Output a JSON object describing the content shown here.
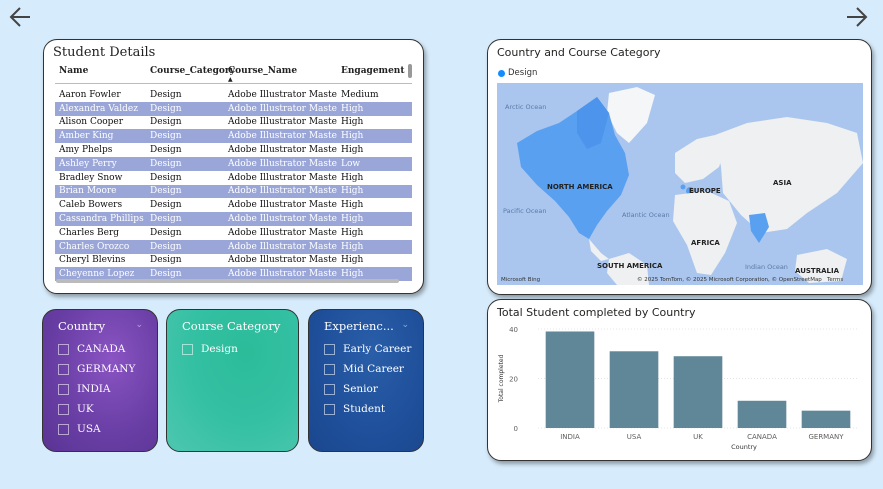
{
  "nav": {
    "back": "back-arrow",
    "forward": "forward-arrow"
  },
  "table": {
    "title": "Student Details",
    "columns": [
      "Name",
      "Course_Category",
      "Course_Name",
      "Engagement Lev"
    ],
    "rows": [
      {
        "name": "Aaron Fowler",
        "category": "Design",
        "course": "Adobe Illustrator Mastery",
        "engagement": "Medium",
        "selected": false
      },
      {
        "name": "Alexandra Valdez",
        "category": "Design",
        "course": "Adobe Illustrator Mastery",
        "engagement": "High",
        "selected": true
      },
      {
        "name": "Alison Cooper",
        "category": "Design",
        "course": "Adobe Illustrator Mastery",
        "engagement": "High",
        "selected": false
      },
      {
        "name": "Amber King",
        "category": "Design",
        "course": "Adobe Illustrator Mastery",
        "engagement": "High",
        "selected": true
      },
      {
        "name": "Amy Phelps",
        "category": "Design",
        "course": "Adobe Illustrator Mastery",
        "engagement": "High",
        "selected": false
      },
      {
        "name": "Ashley Perry",
        "category": "Design",
        "course": "Adobe Illustrator Mastery",
        "engagement": "Low",
        "selected": true
      },
      {
        "name": "Bradley Snow",
        "category": "Design",
        "course": "Adobe Illustrator Mastery",
        "engagement": "High",
        "selected": false
      },
      {
        "name": "Brian Moore",
        "category": "Design",
        "course": "Adobe Illustrator Mastery",
        "engagement": "High",
        "selected": true
      },
      {
        "name": "Caleb Bowers",
        "category": "Design",
        "course": "Adobe Illustrator Mastery",
        "engagement": "High",
        "selected": false
      },
      {
        "name": "Cassandra Phillips",
        "category": "Design",
        "course": "Adobe Illustrator Mastery",
        "engagement": "High",
        "selected": true
      },
      {
        "name": "Charles Berg",
        "category": "Design",
        "course": "Adobe Illustrator Mastery",
        "engagement": "High",
        "selected": false
      },
      {
        "name": "Charles Orozco",
        "category": "Design",
        "course": "Adobe Illustrator Mastery",
        "engagement": "High",
        "selected": true
      },
      {
        "name": "Cheryl Blevins",
        "category": "Design",
        "course": "Adobe Illustrator Mastery",
        "engagement": "High",
        "selected": false
      },
      {
        "name": "Cheyenne Lopez",
        "category": "Design",
        "course": "Adobe Illustrator Mastery",
        "engagement": "High",
        "selected": true
      }
    ]
  },
  "slicers": {
    "country": {
      "title": "Country",
      "items": [
        "CANADA",
        "GERMANY",
        "INDIA",
        "UK",
        "USA"
      ]
    },
    "category": {
      "title": "Course Category",
      "items": [
        "Design"
      ]
    },
    "experience": {
      "title": "Experienc...",
      "items": [
        "Early Career",
        "Mid Career",
        "Senior",
        "Student"
      ]
    }
  },
  "map": {
    "title": "Country and Course Category",
    "legend": "Design",
    "legend_color": "#118dff",
    "continents": [
      "NORTH AMERICA",
      "EUROPE",
      "ASIA",
      "AFRICA",
      "SOUTH AMERICA",
      "AUSTRALIA"
    ],
    "oceans": [
      "Arctic Ocean",
      "Pacific Ocean",
      "Atlantic Ocean",
      "Indian Ocean"
    ],
    "attribution": "© 2025 TomTom, © 2025 Microsoft Corporation, © OpenStreetMap",
    "terms": "Terms",
    "bing": "Microsoft Bing"
  },
  "chart_data": {
    "type": "bar",
    "title": "Total Student completed by Country",
    "categories": [
      "INDIA",
      "USA",
      "UK",
      "CANADA",
      "GERMANY"
    ],
    "values": [
      39,
      31,
      29,
      11,
      7
    ],
    "xlabel": "Country",
    "ylabel": "Total completed",
    "ylim": [
      0,
      40
    ],
    "yticks": [
      0,
      20,
      40
    ],
    "bar_color": "#5f8797",
    "grid": true
  }
}
